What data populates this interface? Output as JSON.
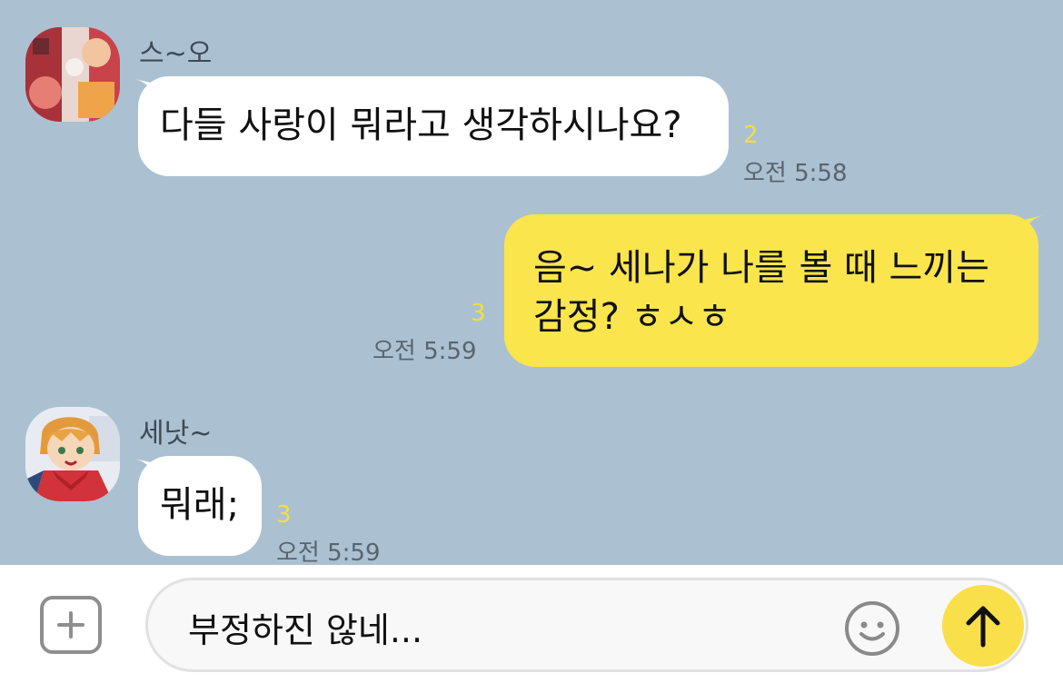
{
  "messages": [
    {
      "sender": "스~오",
      "text": "다들 사랑이 뭐라고 생각하시나요?",
      "unread": "2",
      "time": "오전 5:58"
    },
    {
      "text_line1": "음~ 세나가 나를 볼 때 느끼는",
      "text_line2": "감정? ㅎㅅㅎ",
      "unread": "3",
      "time": "오전 5:59"
    },
    {
      "sender": "세낫~",
      "text": "뭐래;",
      "unread": "3",
      "time": "오전 5:59"
    }
  ],
  "input": {
    "text": "부정하진 않네..."
  },
  "icons": {
    "add": "plus-icon",
    "emoji": "smiley-icon",
    "send": "arrow-up-icon"
  },
  "colors": {
    "background": "#abc1d1",
    "outgoing_bubble": "#fbe54d",
    "incoming_bubble": "#ffffff",
    "unread_count": "#f2df3e",
    "send_button": "#f9e04a"
  }
}
